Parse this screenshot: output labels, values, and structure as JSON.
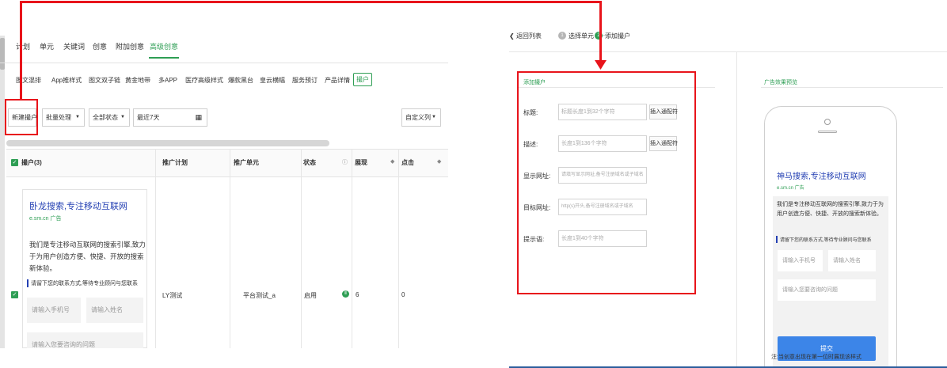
{
  "left_panel": {
    "top_tabs": [
      "计划",
      "单元",
      "关键词",
      "创意",
      "附加创意",
      "高级创意"
    ],
    "sub_tabs": [
      "图文混排",
      "App推样式",
      "图文双子链",
      "黄金地带",
      "多APP",
      "医疗高级样式",
      "爆款黑台",
      "皇云横幅",
      "服务预订",
      "产品详情"
    ],
    "sub_tab_active": "撮户",
    "toolbar": {
      "new_button": "新建撮户",
      "batch": "批量处理",
      "status_filter": "全部状态",
      "date_range": "最近7天",
      "custom_columns": "自定义列"
    },
    "table": {
      "headers": [
        "撮户(3)",
        "推广计划",
        "推广单元",
        "状态",
        "展现",
        "点击"
      ],
      "row": {
        "plan": "LY测试",
        "unit": "平台测试_a",
        "status": "启用",
        "impressions": "6",
        "clicks": "0"
      }
    },
    "ad_preview": {
      "title": "卧龙搜索,专注移动互联网",
      "url": "e.sm.cn 广告",
      "description": "我们是专注移动互联网的搜索引擎,致力于为用户创造方便、快捷、开放的搜索新体验。",
      "lead_prompt": "请留下您的联系方式,等待专业顾问与您联系",
      "phone_placeholder": "请输入手机号",
      "name_placeholder": "请输入姓名",
      "question_placeholder": "请输入您要咨询的问题"
    }
  },
  "right_panel": {
    "back_label": "返回列表",
    "steps": [
      {
        "num": "1",
        "label": "选择单元"
      },
      {
        "num": "2",
        "label": "添加撮户"
      }
    ],
    "step_separator": "——",
    "form_title": "添加撮户",
    "preview_title": "广告效果预览",
    "form": {
      "fields": [
        {
          "label": "标题:",
          "placeholder": "标题长度1到32个字符",
          "button": "插入通配符"
        },
        {
          "label": "描述:",
          "placeholder": "长度1到136个字符",
          "button": "插入通配符"
        },
        {
          "label": "显示网址:",
          "placeholder": "请填写显示网址,备号注册域名或子域名",
          "button": ""
        },
        {
          "label": "目标网址:",
          "placeholder": "http(s)开头,备号注册域名或子域名",
          "button": ""
        },
        {
          "label": "提示语:",
          "placeholder": "长度1到40个字符",
          "button": ""
        }
      ]
    },
    "phone_preview": {
      "title": "神马搜索,专注移动互联网",
      "url": "e.sm.cn 广告",
      "description": "我们是专注移动互联网的搜索引擎,致力于为用户创造方便、快捷、开放的搜索新体验。",
      "lead_prompt": "请留下您的联系方式,等待专业顾问与您联系",
      "phone_placeholder": "请输入手机号",
      "name_placeholder": "请输入姓名",
      "question_placeholder": "请输入您要咨询的问题",
      "submit": "提交",
      "note": "注:当创意出现在第一位时展现该样式"
    }
  },
  "icons": {
    "calendar": "calendar-icon",
    "back": "chevron-left-icon",
    "dropdown": "caret-down-icon",
    "sort": "sort-icon",
    "help": "help-icon"
  },
  "colors": {
    "accent": "#2e9e54",
    "link": "#2440b3",
    "submit": "#3c85e8",
    "annotation": "#e8141b"
  }
}
